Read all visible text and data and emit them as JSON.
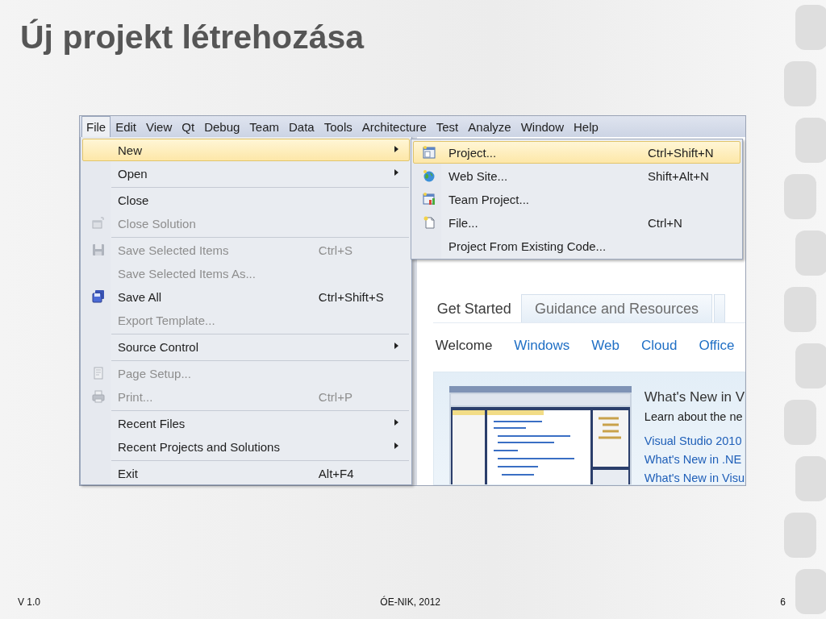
{
  "title": "Új projekt létrehozása",
  "menu_bar": [
    {
      "label": "File",
      "selected": true
    },
    {
      "label": "Edit",
      "selected": false
    },
    {
      "label": "View",
      "selected": false
    },
    {
      "label": "Qt",
      "selected": false
    },
    {
      "label": "Debug",
      "selected": false
    },
    {
      "label": "Team",
      "selected": false
    },
    {
      "label": "Data",
      "selected": false
    },
    {
      "label": "Tools",
      "selected": false
    },
    {
      "label": "Architecture",
      "selected": false
    },
    {
      "label": "Test",
      "selected": false
    },
    {
      "label": "Analyze",
      "selected": false
    },
    {
      "label": "Window",
      "selected": false
    },
    {
      "label": "Help",
      "selected": false
    }
  ],
  "file_menu": [
    {
      "label": "New",
      "submenu": true,
      "disabled": false,
      "selected": true,
      "separator_before": false
    },
    {
      "label": "Open",
      "submenu": true,
      "disabled": false,
      "selected": false,
      "separator_before": false
    },
    {
      "label": "Close",
      "submenu": false,
      "disabled": false,
      "selected": false,
      "separator_before": true
    },
    {
      "label": "Close Solution",
      "kind": "window",
      "submenu": false,
      "disabled": true,
      "selected": false,
      "separator_before": false
    },
    {
      "label": "Save Selected Items",
      "shortcut": "Ctrl+S",
      "kind": "save",
      "submenu": false,
      "disabled": true,
      "selected": false,
      "separator_before": true
    },
    {
      "label": "Save Selected Items As...",
      "submenu": false,
      "disabled": true,
      "selected": false,
      "separator_before": false
    },
    {
      "label": "Save All",
      "shortcut": "Ctrl+Shift+S",
      "kind": "saveall",
      "submenu": false,
      "disabled": false,
      "selected": false,
      "separator_before": false
    },
    {
      "label": "Export Template...",
      "submenu": false,
      "disabled": true,
      "selected": false,
      "separator_before": false
    },
    {
      "label": "Source Control",
      "submenu": true,
      "disabled": false,
      "selected": false,
      "separator_before": true
    },
    {
      "label": "Page Setup...",
      "kind": "page",
      "submenu": false,
      "disabled": true,
      "selected": false,
      "separator_before": true
    },
    {
      "label": "Print...",
      "shortcut": "Ctrl+P",
      "kind": "print",
      "submenu": false,
      "disabled": true,
      "selected": false,
      "separator_before": false
    },
    {
      "label": "Recent Files",
      "submenu": true,
      "disabled": false,
      "selected": false,
      "separator_before": true
    },
    {
      "label": "Recent Projects and Solutions",
      "submenu": true,
      "disabled": false,
      "selected": false,
      "separator_before": false
    },
    {
      "label": "Exit",
      "shortcut": "Alt+F4",
      "submenu": false,
      "disabled": false,
      "selected": false,
      "separator_before": true
    }
  ],
  "new_submenu": [
    {
      "label": "Project...",
      "shortcut": "Ctrl+Shift+N",
      "kind": "project",
      "selected": true
    },
    {
      "label": "Web Site...",
      "shortcut": "Shift+Alt+N",
      "kind": "globe",
      "selected": false
    },
    {
      "label": "Team Project...",
      "kind": "team",
      "selected": false
    },
    {
      "label": "File...",
      "shortcut": "Ctrl+N",
      "kind": "file",
      "selected": false
    },
    {
      "label": "Project From Existing Code...",
      "selected": false
    }
  ],
  "start_page": {
    "tabs": [
      {
        "label": "Get Started",
        "selected": true
      },
      {
        "label": "Guidance and Resources",
        "selected": false
      }
    ],
    "subnav": [
      {
        "label": "Welcome",
        "selected": true
      },
      {
        "label": "Windows",
        "selected": false
      },
      {
        "label": "Web",
        "selected": false
      },
      {
        "label": "Cloud",
        "selected": false
      },
      {
        "label": "Office",
        "selected": false
      }
    ],
    "card": {
      "heading": "What's New in V",
      "text": "Learn about the ne",
      "links": [
        "Visual Studio 2010",
        "What's New in .NE",
        "What's New in Visu"
      ]
    }
  },
  "footer": {
    "version": "V 1.0",
    "center": "ÓE-NIK, 2012",
    "page": "6"
  }
}
